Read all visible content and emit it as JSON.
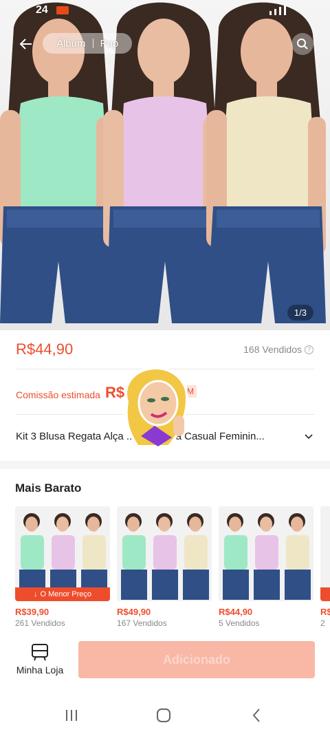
{
  "status_bar": {
    "time": "24"
  },
  "nav": {
    "tabs": [
      "Álbum",
      "Pop"
    ]
  },
  "hero": {
    "image_counter": "1/3",
    "top_colors": [
      "#9fe8c6",
      "#e8c3e8",
      "#efe6c6"
    ],
    "shorts_color": "#2f4f86"
  },
  "price": {
    "value": "R$44,90",
    "sold": "168 Vendidos"
  },
  "commission": {
    "label": "Comissão estimada",
    "value": "R$",
    "tag": "M"
  },
  "product": {
    "title": "Kit 3 Blusa Regata Alça ... Camiseta Casual Feminin..."
  },
  "cheaper": {
    "title": "Mais Barato",
    "badge": "O Menor Preço",
    "items": [
      {
        "price": "R$39,90",
        "sold": "261 Vendidos"
      },
      {
        "price": "R$49,90",
        "sold": "167 Vendidos"
      },
      {
        "price": "R$44,90",
        "sold": "5 Vendidos"
      },
      {
        "price": "R$",
        "sold": "2"
      }
    ]
  },
  "bottom": {
    "store_label": "Minha Loja",
    "add_label": "Adicionado"
  },
  "colors": {
    "accent": "#ee4d2d",
    "disabled_button": "#f9b7a6"
  }
}
